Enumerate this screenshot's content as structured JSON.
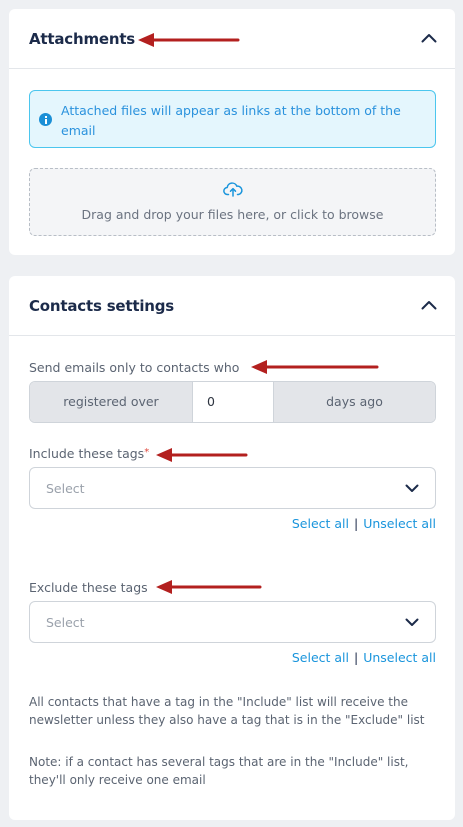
{
  "attachments": {
    "title": "Attachments",
    "info_text": "Attached files will appear as links at the bottom of the email",
    "dropzone_text": "Drag and drop your files here, or click to browse"
  },
  "contacts": {
    "title": "Contacts settings",
    "send_label": "Send emails only to contacts who",
    "condition_value": "registered over",
    "days_value": "0",
    "days_suffix": "days ago",
    "include_label": "Include these tags",
    "include_required_mark": "*",
    "include_placeholder": "Select",
    "exclude_label": "Exclude these tags",
    "exclude_placeholder": "Select",
    "select_all": "Select all",
    "separator": "|",
    "unselect_all": "Unselect all",
    "note_1": "All contacts that have a tag in the \"Include\" list will receive the newsletter unless they also have a tag that is in the \"Exclude\" list",
    "note_2": "Note: if a contact has several tags that are in the \"Include\" list, they'll only receive one email"
  },
  "colors": {
    "annotation_arrow": "#b3201f",
    "accent": "#1a95dc",
    "title": "#1c2b4a"
  },
  "icons": {
    "collapse": "chevron-up-icon",
    "info": "info-icon",
    "upload": "cloud-upload-icon",
    "dropdown": "chevron-down-icon"
  }
}
